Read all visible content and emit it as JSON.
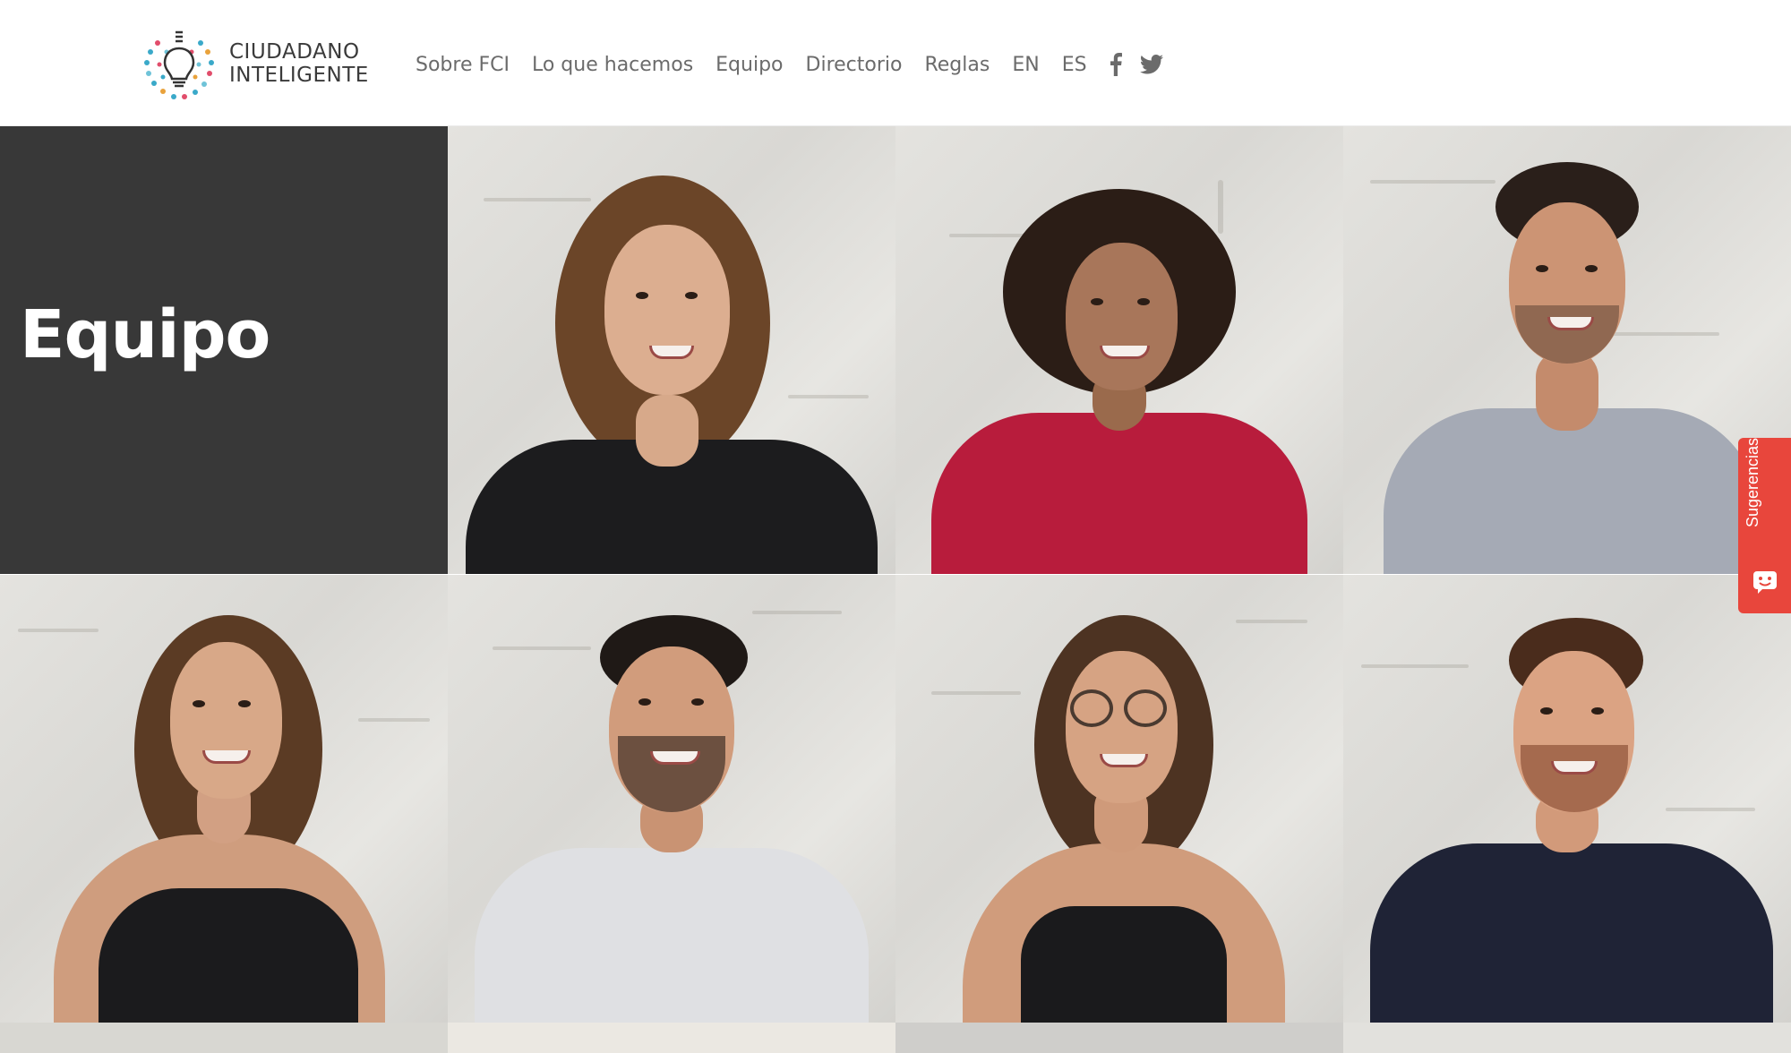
{
  "brand": {
    "line1": "CIUDADANO",
    "line2": "INTELIGENTE",
    "logo_icon": "lightbulb-icon"
  },
  "nav": {
    "items": [
      {
        "label": "Sobre FCI"
      },
      {
        "label": "Lo que hacemos"
      },
      {
        "label": "Equipo"
      },
      {
        "label": "Directorio"
      },
      {
        "label": "Reglas"
      },
      {
        "label": "EN"
      },
      {
        "label": "ES"
      }
    ],
    "social": [
      "facebook-icon",
      "twitter-icon"
    ]
  },
  "page": {
    "title": "Equipo"
  },
  "team": {
    "photos": [
      "team-member-photo",
      "team-member-photo",
      "team-member-photo",
      "team-member-photo",
      "team-member-photo",
      "team-member-photo",
      "team-member-photo"
    ]
  },
  "feedback": {
    "label": "Sugerencias",
    "icon": "chat-face-icon",
    "color": "#e8463c"
  },
  "colors": {
    "title_tile": "#383838",
    "nav_text": "#6b6b6b"
  }
}
